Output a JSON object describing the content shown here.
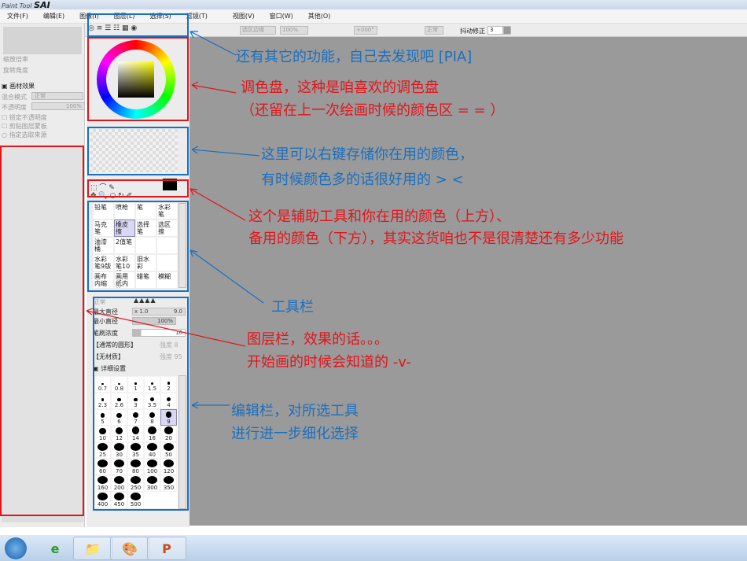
{
  "window": {
    "logo_small": "Paint Tool",
    "logo_big": "SAI"
  },
  "menu": [
    "文件(F)",
    "编辑(E)",
    "图像(I)",
    "图层(L)",
    "选择(S)",
    "滤镜(T)",
    "视图(V)",
    "窗口(W)",
    "其他(O)"
  ],
  "toolbar": {
    "selection_edge": "选区边缘",
    "zoom": "100%",
    "rotate": "+000°",
    "mode": "正常",
    "stabilizer_label": "抖动修正",
    "stabilizer_value": "3"
  },
  "left_panel": {
    "zoom_label": "缩放倍率",
    "rotate_label": "旋转角度",
    "effects": "画材效果",
    "blend_label": "混合模式",
    "blend_value": "正常",
    "opacity_label": "不透明度",
    "opacity_value": "100%",
    "checks": [
      "锁定不透明度",
      "剪贴图层蒙板",
      "指定选取来源"
    ]
  },
  "tools": [
    {
      "n": "铅笔"
    },
    {
      "n": "喷枪"
    },
    {
      "n": "笔"
    },
    {
      "n": "水彩笔"
    },
    {
      "n": "马克笔"
    },
    {
      "n": "橡皮擦",
      "sel": true
    },
    {
      "n": "选择笔"
    },
    {
      "n": "选区擦"
    },
    {
      "n": "油漆桶"
    },
    {
      "n": "2值笔"
    },
    {
      "n": ""
    },
    {
      "n": ""
    },
    {
      "n": "水彩笔9版"
    },
    {
      "n": "水彩笔10版"
    },
    {
      "n": "旧水彩"
    },
    {
      "n": ""
    },
    {
      "n": "画布内缩"
    },
    {
      "n": "画用纸内缩"
    },
    {
      "n": "蜡笔"
    },
    {
      "n": "模糊"
    }
  ],
  "brush_settings": {
    "mode": "正常",
    "max_size_label": "最大直径",
    "max_size_mult": "x 1.0",
    "max_size_value": "9.0",
    "min_size_label": "最小直径",
    "min_size_value": "100%",
    "density_label": "笔刷浓度",
    "density_value": "16",
    "density_fraction": 0.16,
    "shape": "【通常的圆形】",
    "shape_strength_label": "强度",
    "shape_strength": "8",
    "texture": "【无材质】",
    "texture_strength_label": "强度",
    "texture_strength": "95",
    "detail": "详细设置"
  },
  "brush_sizes": [
    "0.7",
    "0.8",
    "1",
    "1.5",
    "2",
    "2.3",
    "2.6",
    "3",
    "3.5",
    "4",
    "5",
    "6",
    "7",
    "8",
    "9",
    "10",
    "12",
    "14",
    "16",
    "20",
    "25",
    "30",
    "35",
    "40",
    "50",
    "60",
    "70",
    "80",
    "100",
    "120",
    "160",
    "200",
    "250",
    "300",
    "350",
    "400",
    "450",
    "500"
  ],
  "selected_size": "9",
  "annotations": {
    "a1": "还有其它的功能，自己去发现吧 [PIA]",
    "a2a": "调色盘，这种是咱喜欢的调色盘",
    "a2b": "（还留在上一次绘画时候的颜色区 = = ）",
    "a3a": "这里可以右键存储你在用的颜色，",
    "a3b": "有时候颜色多的话很好用的 > <",
    "a4a": "这个是辅助工具和你在用的颜色（上方）、",
    "a4b": "备用的颜色（下方），其实这货咱也不是很清楚还有多少功能",
    "a5": "工具栏",
    "a6a": "图层栏，效果的话。。。",
    "a6b": "开始画的时候会知道的 -v-",
    "a7a": "编辑栏，对所选工具",
    "a7b": "进行进一步细化选择"
  },
  "colors": {
    "red": "#e2151b",
    "blue": "#1a6fc0",
    "canvas": "#9a9a9a"
  }
}
